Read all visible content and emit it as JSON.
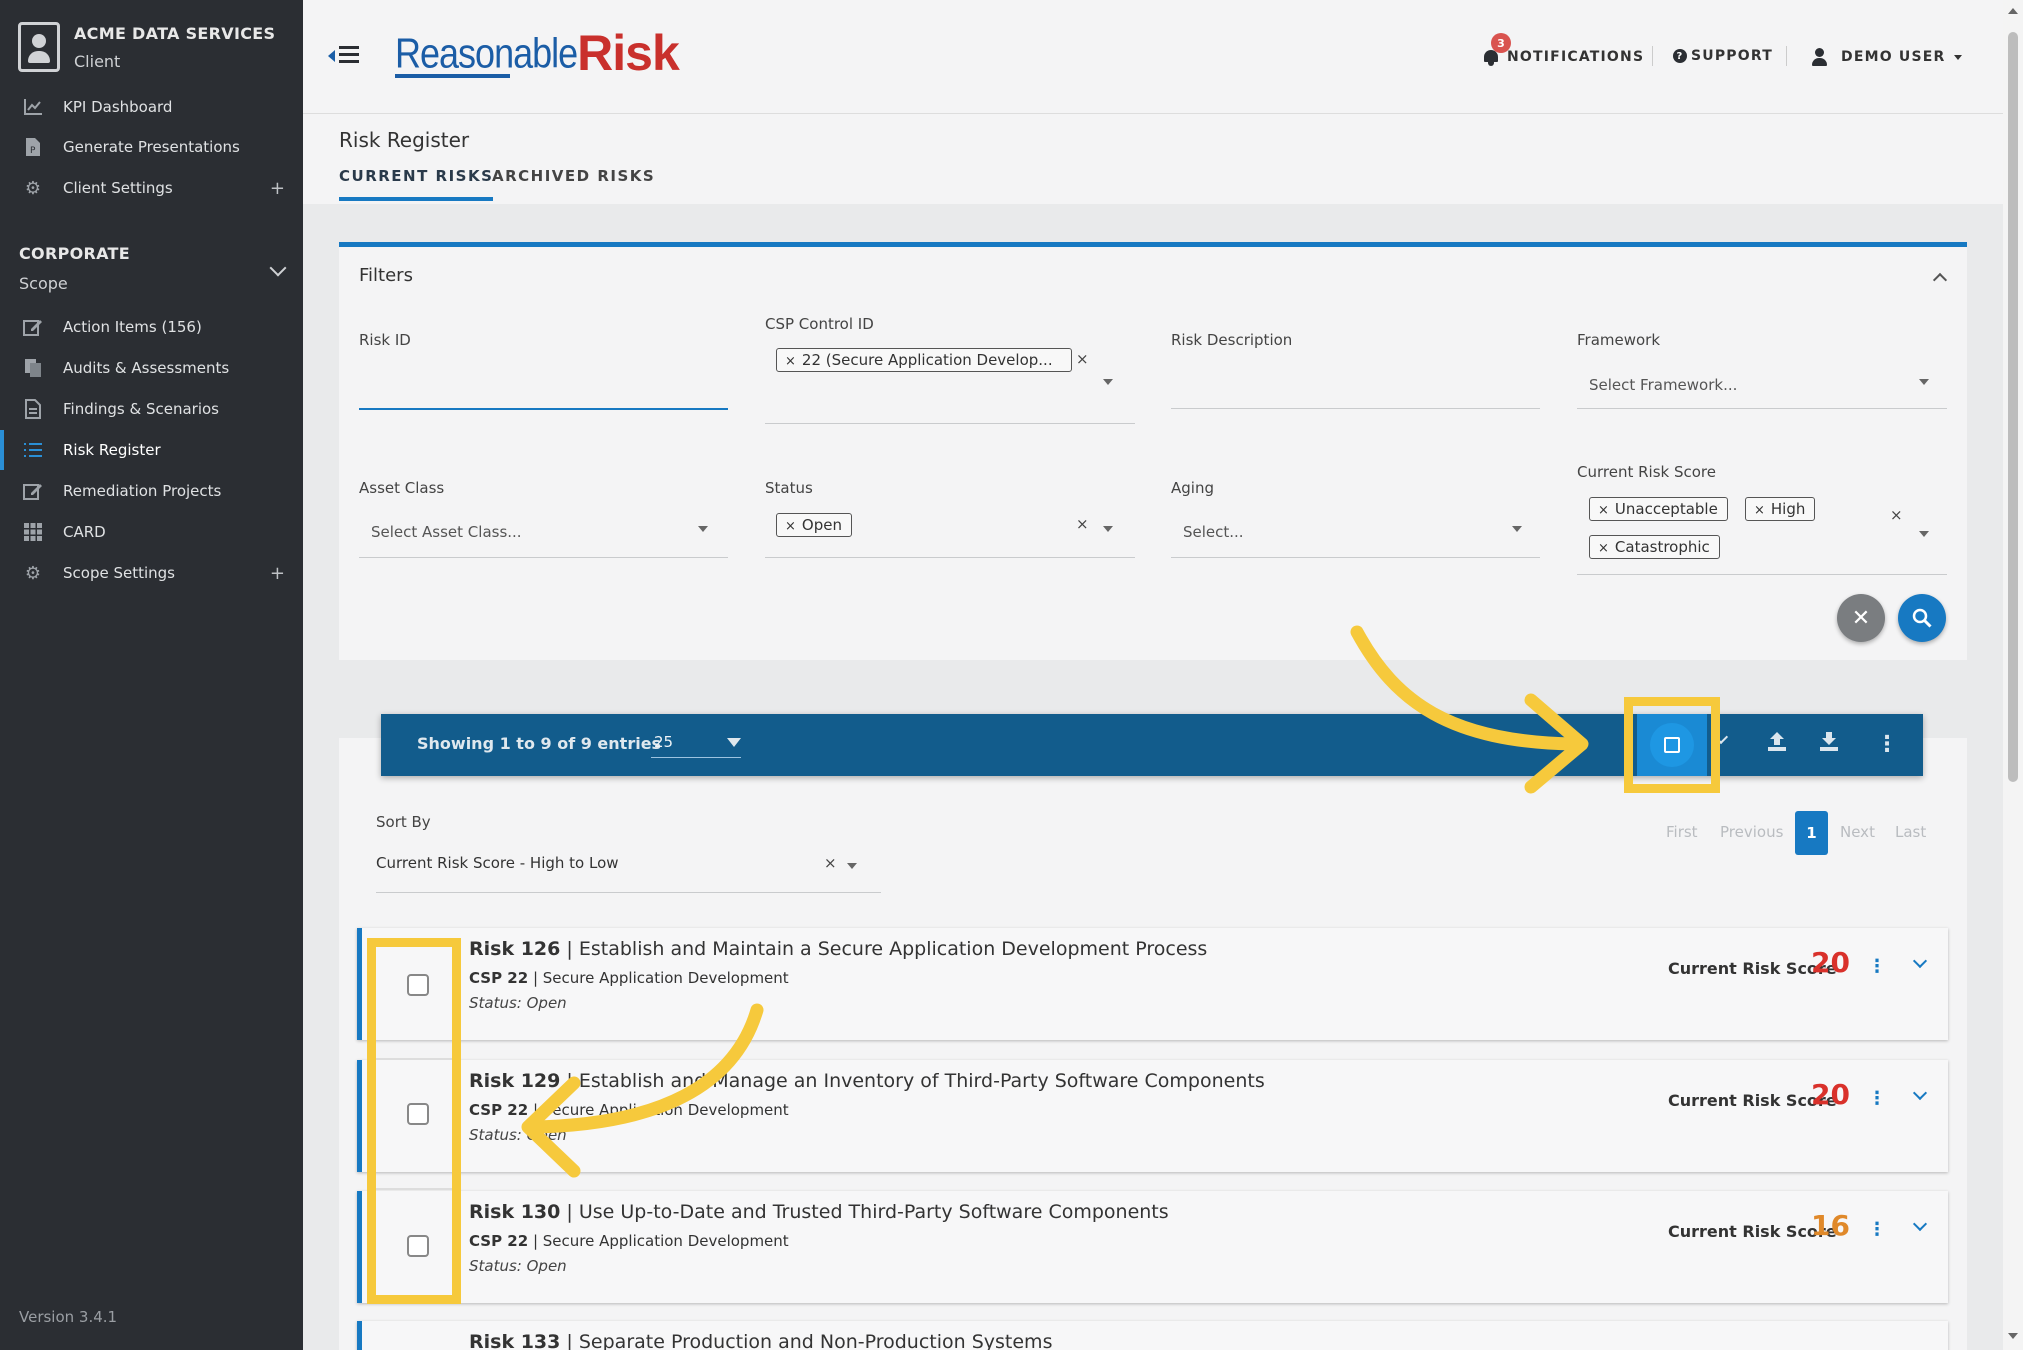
{
  "sidebar": {
    "client_name": "ACME DATA SERVICES",
    "client_role": "Client",
    "top_items": [
      {
        "label": "KPI Dashboard",
        "icon": "chart-line-icon"
      },
      {
        "label": "Generate Presentations",
        "icon": "presentation-file-icon"
      },
      {
        "label": "Client Settings",
        "icon": "gear-icon",
        "expandable": true
      }
    ],
    "section_title": "CORPORATE",
    "section_sub": "Scope",
    "scope_items": [
      {
        "label": "Action Items (156)",
        "icon": "edit-icon"
      },
      {
        "label": "Audits & Assessments",
        "icon": "copy-files-icon"
      },
      {
        "label": "Findings & Scenarios",
        "icon": "document-icon"
      },
      {
        "label": "Risk Register",
        "icon": "list-icon",
        "active": true
      },
      {
        "label": "Remediation Projects",
        "icon": "edit-icon"
      },
      {
        "label": "CARD",
        "icon": "grid-icon"
      },
      {
        "label": "Scope Settings",
        "icon": "gear-icon",
        "expandable": true
      }
    ],
    "version": "Version 3.4.1"
  },
  "topbar": {
    "logo_part1": "Reasonable",
    "logo_part2": "Risk",
    "notifications_label": "NOTIFICATIONS",
    "notifications_count": "3",
    "support_label": "SUPPORT",
    "user_label": "DEMO USER"
  },
  "page": {
    "title": "Risk Register",
    "tabs": [
      "CURRENT RISKS",
      "ARCHIVED RISKS"
    ]
  },
  "filters": {
    "title": "Filters",
    "risk_id_label": "Risk ID",
    "csp_label": "CSP Control ID",
    "csp_tag": "22 (Secure Application Develop...",
    "risk_desc_label": "Risk Description",
    "framework_label": "Framework",
    "framework_placeholder": "Select Framework...",
    "asset_class_label": "Asset Class",
    "asset_class_placeholder": "Select Asset Class...",
    "status_label": "Status",
    "status_tag": "Open",
    "aging_label": "Aging",
    "aging_placeholder": "Select...",
    "score_label": "Current Risk Score",
    "score_tags": [
      "Unacceptable",
      "High",
      "Catastrophic"
    ]
  },
  "results": {
    "showing": "Showing 1 to 9 of 9 entries",
    "page_size": "25",
    "sort_label": "Sort By",
    "sort_value": "Current Risk Score - High to Low",
    "pagination": {
      "first": "First",
      "previous": "Previous",
      "current": "1",
      "next": "Next",
      "last": "Last"
    },
    "score_caption": "Current Risk Score",
    "risks": [
      {
        "id": "Risk 126",
        "title": "Establish and Maintain a Secure Application Development Process",
        "csp": "CSP 22",
        "csp_name": "Secure Application Development",
        "status": "Status: Open",
        "score": "20",
        "score_color": "#d9312b"
      },
      {
        "id": "Risk 129",
        "title": "Establish and Manage an Inventory of Third-Party Software Components",
        "csp": "CSP 22",
        "csp_name": "Secure Application Development",
        "status": "Status: Open",
        "score": "20",
        "score_color": "#d9312b"
      },
      {
        "id": "Risk 130",
        "title": "Use Up-to-Date and Trusted Third-Party Software Components",
        "csp": "CSP 22",
        "csp_name": "Secure Application Development",
        "status": "Status: Open",
        "score": "16",
        "score_color": "#e0892a"
      },
      {
        "id": "Risk 133",
        "title": "Separate Production and Non-Production Systems",
        "csp": "",
        "csp_name": "",
        "status": "",
        "score": "",
        "score_color": "#e0892a"
      }
    ]
  },
  "colors": {
    "highlight": "#f6c93c",
    "primary": "#1779c2",
    "toolbar": "#125c8c"
  }
}
